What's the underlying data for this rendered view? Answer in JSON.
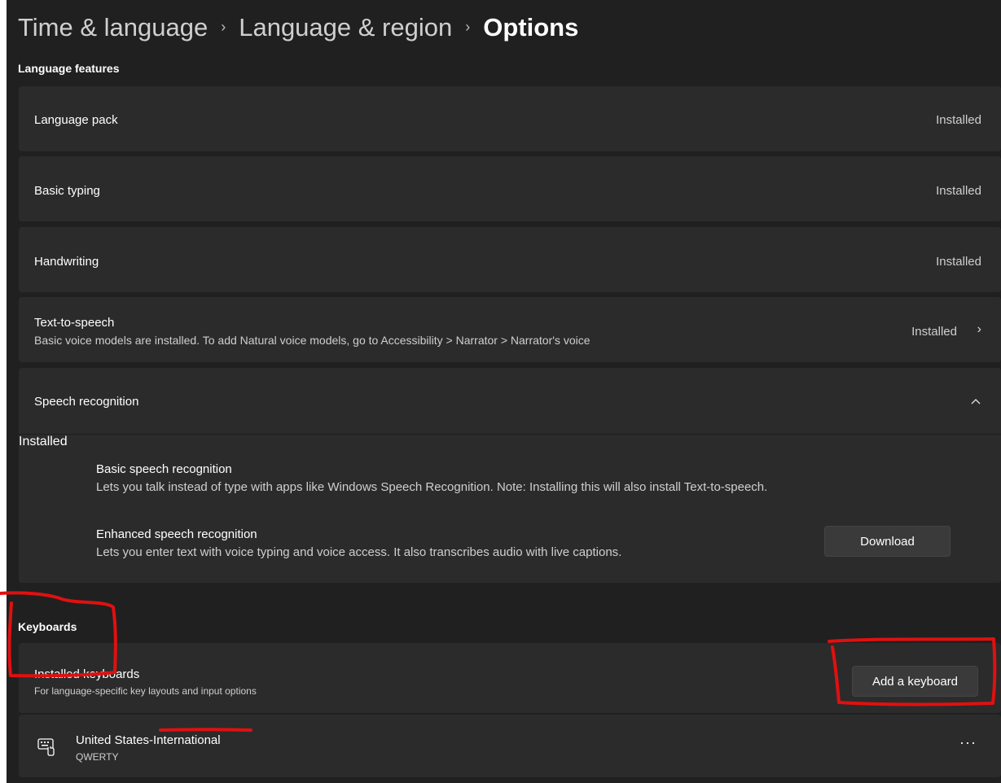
{
  "breadcrumb": {
    "item1": "Time & language",
    "item2": "Language & region",
    "current": "Options"
  },
  "language_features": {
    "title": "Language features",
    "language_pack": {
      "label": "Language pack",
      "status": "Installed"
    },
    "basic_typing": {
      "label": "Basic typing",
      "status": "Installed"
    },
    "handwriting": {
      "label": "Handwriting",
      "status": "Installed"
    },
    "text_to_speech": {
      "label": "Text-to-speech",
      "description": "Basic voice models are installed. To add Natural voice models, go to Accessibility > Narrator > Narrator's voice",
      "status": "Installed"
    },
    "speech_recognition": {
      "label": "Speech recognition",
      "basic": {
        "label": "Basic speech recognition",
        "description": "Lets you talk instead of type with apps like Windows Speech Recognition. Note: Installing this will also install Text-to-speech.",
        "status": "Installed"
      },
      "enhanced": {
        "label": "Enhanced speech recognition",
        "description": "Lets you enter text with voice typing and voice access. It also transcribes audio with live captions.",
        "button": "Download"
      }
    }
  },
  "keyboards": {
    "title": "Keyboards",
    "installed": {
      "label": "Installed keyboards",
      "description": "For language-specific key layouts and input options",
      "button": "Add a keyboard"
    },
    "items": [
      {
        "name": "United States-International",
        "layout": "QWERTY",
        "more": "···"
      }
    ]
  },
  "icons": {
    "breadcrumb_separator": "chevron-right-icon",
    "tts_chevron": "chevron-right-icon",
    "speech_chevron": "chevron-up-icon",
    "keyboard": "keyboard-icon",
    "more": "more-options-icon"
  },
  "colors": {
    "background": "#202020",
    "card": "#2b2b2b",
    "button": "#3a3a3a",
    "annotation": "#e01010"
  }
}
